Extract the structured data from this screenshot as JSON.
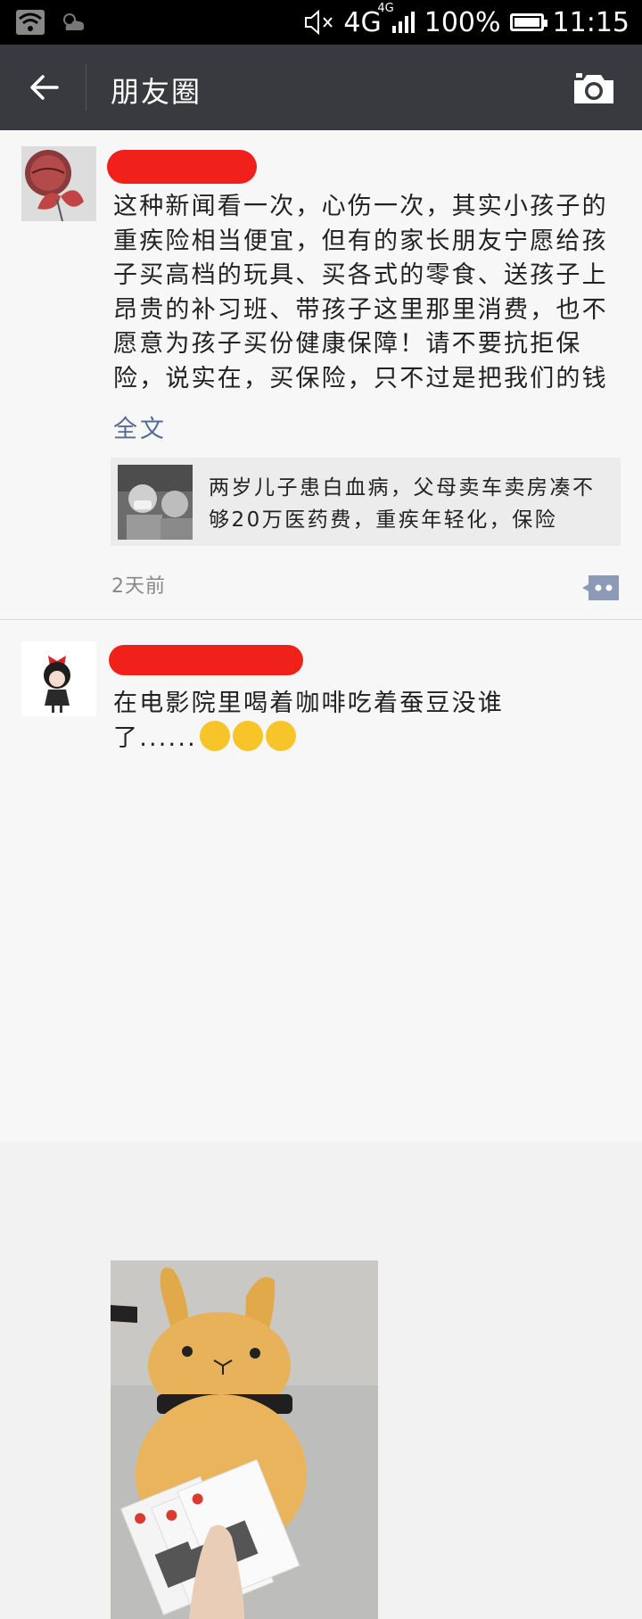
{
  "status_bar": {
    "network": "4G",
    "network_sup": "4G",
    "battery": "100%",
    "battery_level": 1.0,
    "time": "11:15"
  },
  "nav": {
    "title": "朋友圈"
  },
  "posts": [
    {
      "text": "这种新闻看一次，心伤一次，其实小孩子的重疾险相当便宜，但有的家长朋友宁愿给孩子买高档的玩具、买各式的零食、送孩子上昂贵的补习班、带孩子这里那里消费，也不愿意为孩子买份健康保障！请不要抗拒保险，说实在，买保险，只不过是把我们的钱",
      "full_text_link": "全文",
      "share_title": "两岁儿子患白血病，父母卖车卖房凑不够20万医药费，重疾年轻化，保险",
      "time": "2天前"
    },
    {
      "text": "在电影院里喝着咖啡吃着蚕豆没谁了......",
      "emoji_count": 3
    }
  ],
  "colors": {
    "navbar": "#393a3f",
    "link": "#576b95",
    "redaction": "#f0201b",
    "background": "#f7f7f7"
  },
  "icons": [
    "wifi-icon",
    "weather-icon",
    "mute-icon",
    "signal-icon",
    "battery-icon",
    "back-arrow-icon",
    "camera-icon",
    "comment-icon"
  ]
}
